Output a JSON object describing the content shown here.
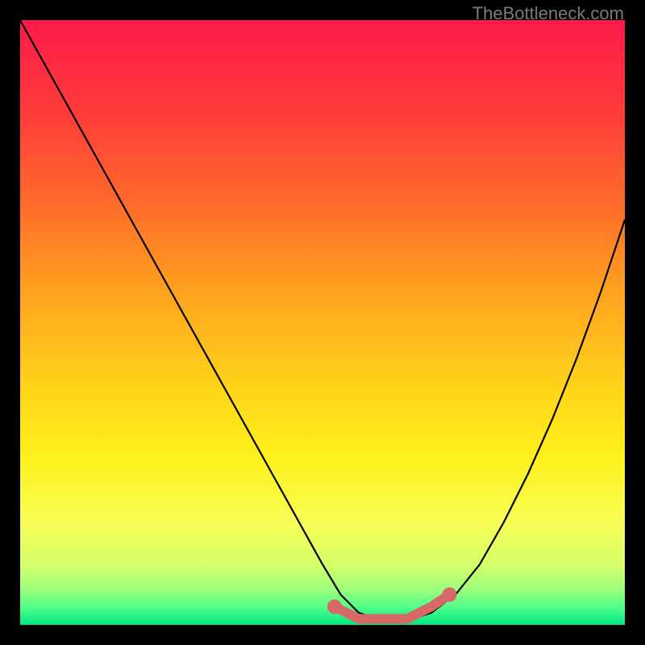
{
  "watermark": "TheBottleneck.com",
  "chart_data": {
    "type": "line",
    "title": "",
    "xlabel": "",
    "ylabel": "",
    "xlim": [
      0,
      1
    ],
    "ylim": [
      0,
      1
    ],
    "series": [
      {
        "name": "curve",
        "color": "#000000",
        "x": [
          0.0,
          0.05,
          0.1,
          0.15,
          0.2,
          0.25,
          0.3,
          0.35,
          0.4,
          0.45,
          0.5,
          0.53,
          0.56,
          0.59,
          0.62,
          0.65,
          0.68,
          0.72,
          0.76,
          0.8,
          0.84,
          0.88,
          0.92,
          0.96,
          1.0
        ],
        "y": [
          1.0,
          0.91,
          0.82,
          0.73,
          0.64,
          0.55,
          0.46,
          0.37,
          0.28,
          0.19,
          0.1,
          0.05,
          0.02,
          0.01,
          0.01,
          0.01,
          0.02,
          0.05,
          0.1,
          0.17,
          0.25,
          0.34,
          0.44,
          0.55,
          0.67
        ]
      },
      {
        "name": "bottom-markers",
        "color": "#d66868",
        "x": [
          0.52,
          0.54,
          0.56,
          0.58,
          0.6,
          0.62,
          0.64,
          0.66,
          0.68,
          0.71
        ],
        "y": [
          0.03,
          0.02,
          0.01,
          0.01,
          0.01,
          0.01,
          0.01,
          0.02,
          0.03,
          0.05
        ]
      }
    ],
    "background_gradient": {
      "type": "vertical",
      "stops": [
        {
          "pos": 0.0,
          "color": "#ff1a4a"
        },
        {
          "pos": 0.15,
          "color": "#ff3b3b"
        },
        {
          "pos": 0.3,
          "color": "#ff6a2b"
        },
        {
          "pos": 0.45,
          "color": "#ffa21e"
        },
        {
          "pos": 0.6,
          "color": "#ffd21a"
        },
        {
          "pos": 0.72,
          "color": "#fff01a"
        },
        {
          "pos": 0.83,
          "color": "#f8ff55"
        },
        {
          "pos": 0.9,
          "color": "#d6ff6a"
        },
        {
          "pos": 0.94,
          "color": "#9fff7a"
        },
        {
          "pos": 0.97,
          "color": "#55ff8a"
        },
        {
          "pos": 1.0,
          "color": "#00e884"
        }
      ]
    }
  }
}
